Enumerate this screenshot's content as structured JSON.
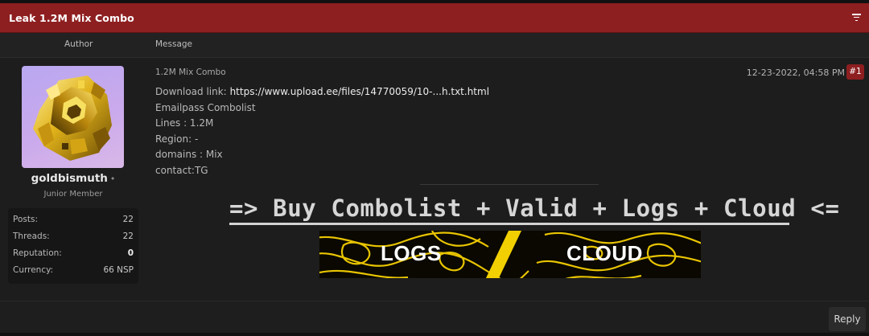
{
  "thread": {
    "title": "Leak 1.2M Mix Combo",
    "filter_icon": "filter-icon"
  },
  "columns": {
    "author": "Author",
    "message": "Message"
  },
  "author": {
    "avatar_icon": "bismuth-crystal-avatar",
    "username": "goldbismuth",
    "status_dot": "•",
    "user_title": "Junior Member",
    "stats": [
      {
        "label": "Posts:",
        "value": "22"
      },
      {
        "label": "Threads:",
        "value": "22"
      },
      {
        "label": "Reputation:",
        "value": "0"
      },
      {
        "label": "Currency:",
        "value": "66 NSP"
      }
    ]
  },
  "post": {
    "subject": "1.2M Mix Combo",
    "date": "12-23-2022, 04:58 PM",
    "number": "#1",
    "download_label": "Download link:",
    "download_url": "https://www.upload.ee/files/14770059/10-...h.txt.html",
    "lines": [
      "Emailpass Combolist",
      "Lines : 1.2M",
      "Region: -",
      "domains : Mix",
      "contact:TG"
    ],
    "promo": "=> Buy Combolist + Valid + Logs + Cloud <=",
    "banner": {
      "left": "LOGS",
      "right": "CLOUD"
    }
  },
  "footer": {
    "reply_label": "Reply"
  },
  "colors": {
    "accent": "#8e1f20",
    "background": "#1b1b1b",
    "banner_yellow": "#f0c800"
  }
}
